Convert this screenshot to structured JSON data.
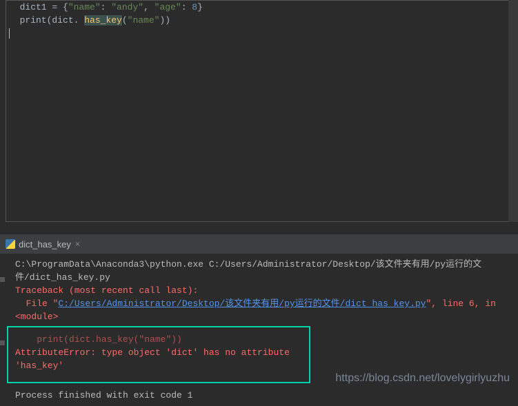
{
  "code": {
    "line1_pre": "  dict1 = {",
    "key1": "\"name\"",
    "sep1": ": ",
    "val1": "\"andy\"",
    "comma1": ", ",
    "key2": "\"age\"",
    "sep2": ": ",
    "val2": "8",
    "close1": "}",
    "line2_pre": "  print",
    "line2_paren1": "(",
    "line2_obj": "dict. ",
    "line2_method": "has_key",
    "line2_paren2": "(",
    "line2_arg": "\"name\"",
    "line2_paren3": "))"
  },
  "tab": {
    "name": "dict_has_key",
    "close": "×"
  },
  "console": {
    "cmd": "C:\\ProgramData\\Anaconda3\\python.exe C:/Users/Administrator/Desktop/该文件夹有用/py运行的文件/dict_has_key.py",
    "traceback": "Traceback (most recent call last):",
    "file_pre": "  File \"",
    "file_link": "C:/Users/Administrator/Desktop/该文件夹有用/py运行的文件/dict_has_key.py",
    "file_post": "\", line 6, in <module>",
    "stmt": "    print(dict.has_key(\"name\"))",
    "error": "AttributeError: type object 'dict' has no attribute 'has_key'",
    "exit": "Process finished with exit code 1"
  },
  "watermark": "https://blog.csdn.net/lovelygirlyuzhu"
}
